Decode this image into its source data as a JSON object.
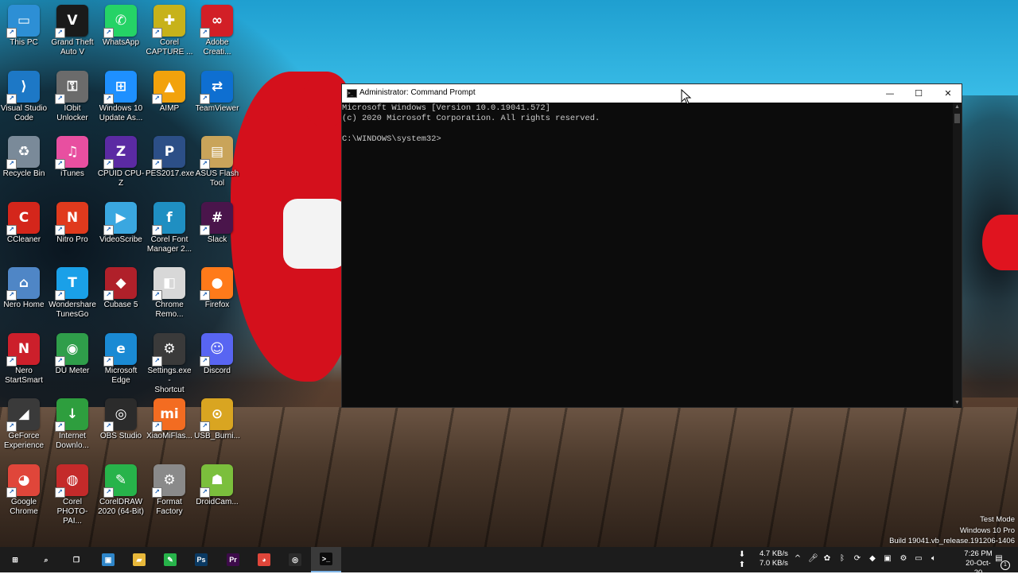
{
  "desktop": {
    "icons": [
      {
        "label": "This PC",
        "glyph": "▭",
        "color": "#2d8fd5"
      },
      {
        "label": "Grand Theft\nAuto V",
        "glyph": "V",
        "color": "#1a1a1a"
      },
      {
        "label": "WhatsApp",
        "glyph": "✆",
        "color": "#25d366"
      },
      {
        "label": "Corel\nCAPTURE ...",
        "glyph": "✚",
        "color": "#c7b21a"
      },
      {
        "label": "Adobe\nCreati...",
        "glyph": "∞",
        "color": "#d21f26"
      },
      {
        "label": "Visual Studio\nCode",
        "glyph": "⟩",
        "color": "#1d78c6"
      },
      {
        "label": "IObit\nUnlocker",
        "glyph": "⚿",
        "color": "#6b6b6b"
      },
      {
        "label": "Windows 10\nUpdate As...",
        "glyph": "⊞",
        "color": "#1e90ff"
      },
      {
        "label": "AIMP",
        "glyph": "▲",
        "color": "#f2a20c"
      },
      {
        "label": "TeamViewer",
        "glyph": "⇄",
        "color": "#0e6fd1"
      },
      {
        "label": "Recycle Bin",
        "glyph": "♻",
        "color": "#7a8a99"
      },
      {
        "label": "iTunes",
        "glyph": "♫",
        "color": "#e84fa0"
      },
      {
        "label": "CPUID CPU-Z",
        "glyph": "Z",
        "color": "#5b2aa3"
      },
      {
        "label": "PES2017.exe",
        "glyph": "P",
        "color": "#2c4f87"
      },
      {
        "label": "ASUS Flash\nTool",
        "glyph": "▤",
        "color": "#c9a45a"
      },
      {
        "label": "CCleaner",
        "glyph": "C",
        "color": "#d4261b"
      },
      {
        "label": "Nitro Pro",
        "glyph": "N",
        "color": "#e03a1d"
      },
      {
        "label": "VideoScribe",
        "glyph": "▶",
        "color": "#3aa7e0"
      },
      {
        "label": "Corel Font\nManager 2...",
        "glyph": "f",
        "color": "#1f8fc2"
      },
      {
        "label": "Slack",
        "glyph": "#",
        "color": "#4a154b"
      },
      {
        "label": "Nero Home",
        "glyph": "⌂",
        "color": "#4f86c6"
      },
      {
        "label": "Wondershare\nTunesGo",
        "glyph": "T",
        "color": "#1aa0e8"
      },
      {
        "label": "Cubase 5",
        "glyph": "◆",
        "color": "#b0202a"
      },
      {
        "label": "Chrome\nRemo...",
        "glyph": "◧",
        "color": "#d8d8d8"
      },
      {
        "label": "Firefox",
        "glyph": "●",
        "color": "#ff7a1a"
      },
      {
        "label": "Nero\nStartSmart",
        "glyph": "N",
        "color": "#cc1f2b"
      },
      {
        "label": "DU Meter",
        "glyph": "◉",
        "color": "#2f9e4a"
      },
      {
        "label": "Microsoft\nEdge",
        "glyph": "e",
        "color": "#1a8ad4"
      },
      {
        "label": "Settings.exe -\nShortcut",
        "glyph": "⚙",
        "color": "#3a3a3a"
      },
      {
        "label": "Discord",
        "glyph": "☺",
        "color": "#5865f2"
      },
      {
        "label": "GeForce\nExperience",
        "glyph": "◢",
        "color": "#3a3a3a"
      },
      {
        "label": "Internet\nDownlo...",
        "glyph": "↓",
        "color": "#2e9e3e"
      },
      {
        "label": "OBS Studio",
        "glyph": "◎",
        "color": "#2b2b2b"
      },
      {
        "label": "XiaoMiFlas...",
        "glyph": "mi",
        "color": "#f36c21"
      },
      {
        "label": "USB_Burni...",
        "glyph": "⊙",
        "color": "#d9a521"
      },
      {
        "label": "Google\nChrome",
        "glyph": "◕",
        "color": "#e0463a"
      },
      {
        "label": "Corel\nPHOTO-PAI...",
        "glyph": "◍",
        "color": "#c42a2a"
      },
      {
        "label": "CorelDRAW\n2020 (64-Bit)",
        "glyph": "✎",
        "color": "#27b34a"
      },
      {
        "label": "Format\nFactory",
        "glyph": "⚙",
        "color": "#8a8a8a"
      },
      {
        "label": "DroidCam...",
        "glyph": "☗",
        "color": "#7bbf3c"
      }
    ]
  },
  "cmd": {
    "title": "Administrator: Command Prompt",
    "lines": [
      "Microsoft Windows [Version 10.0.19041.572]",
      "(c) 2020 Microsoft Corporation. All rights reserved.",
      "",
      "C:\\WINDOWS\\system32>"
    ],
    "buttons": {
      "minimize": "—",
      "maximize": "☐",
      "close": "✕"
    }
  },
  "watermark": {
    "line1": "Test Mode",
    "line2": "Windows 10 Pro",
    "line3": "Build 19041.vb_release.191206-1406"
  },
  "taskbar": {
    "apps": [
      {
        "name": "start-button",
        "glyph": "⊞",
        "color": "#1c1c1c"
      },
      {
        "name": "search-button",
        "glyph": "⌕",
        "color": "#1c1c1c"
      },
      {
        "name": "task-view-button",
        "glyph": "❐",
        "color": "#1c1c1c"
      },
      {
        "name": "taskbar-app-1",
        "glyph": "▣",
        "color": "#2f86c9"
      },
      {
        "name": "taskbar-file-explorer",
        "glyph": "▰",
        "color": "#e8b83a"
      },
      {
        "name": "taskbar-coreldraw",
        "glyph": "✎",
        "color": "#27b34a"
      },
      {
        "name": "taskbar-photoshop",
        "glyph": "Ps",
        "color": "#0b3a63"
      },
      {
        "name": "taskbar-premiere",
        "glyph": "Pr",
        "color": "#3d0b4a"
      },
      {
        "name": "taskbar-chrome",
        "glyph": "◕",
        "color": "#e0463a"
      },
      {
        "name": "taskbar-obs",
        "glyph": "◎",
        "color": "#2b2b2b"
      },
      {
        "name": "taskbar-cmd",
        "glyph": ">_",
        "color": "#0c0c0c"
      }
    ],
    "network_up": "4.7 KB/s",
    "network_down": "7.0 KB/s",
    "time": "7:26 PM",
    "date": "20-Oct-20",
    "notification_count": "1"
  }
}
